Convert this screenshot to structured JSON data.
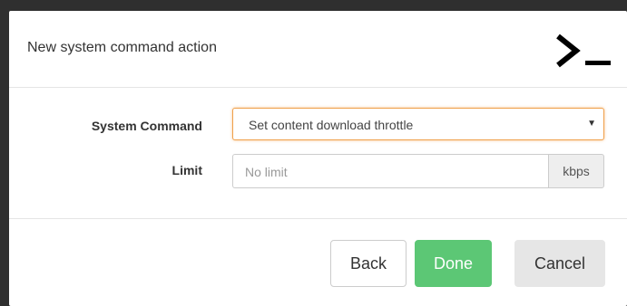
{
  "dialog": {
    "title": "New system command action",
    "icon": "terminal-icon"
  },
  "form": {
    "system_command_label": "System Command",
    "system_command_value": "Set content download throttle",
    "limit_label": "Limit",
    "limit_placeholder": "No limit",
    "limit_unit": "kbps"
  },
  "footer": {
    "back_label": "Back",
    "done_label": "Done",
    "cancel_label": "Cancel"
  },
  "colors": {
    "done_button": "#5cc775",
    "select_focus_border": "#f0a04b",
    "backdrop": "#2f2f2f"
  }
}
